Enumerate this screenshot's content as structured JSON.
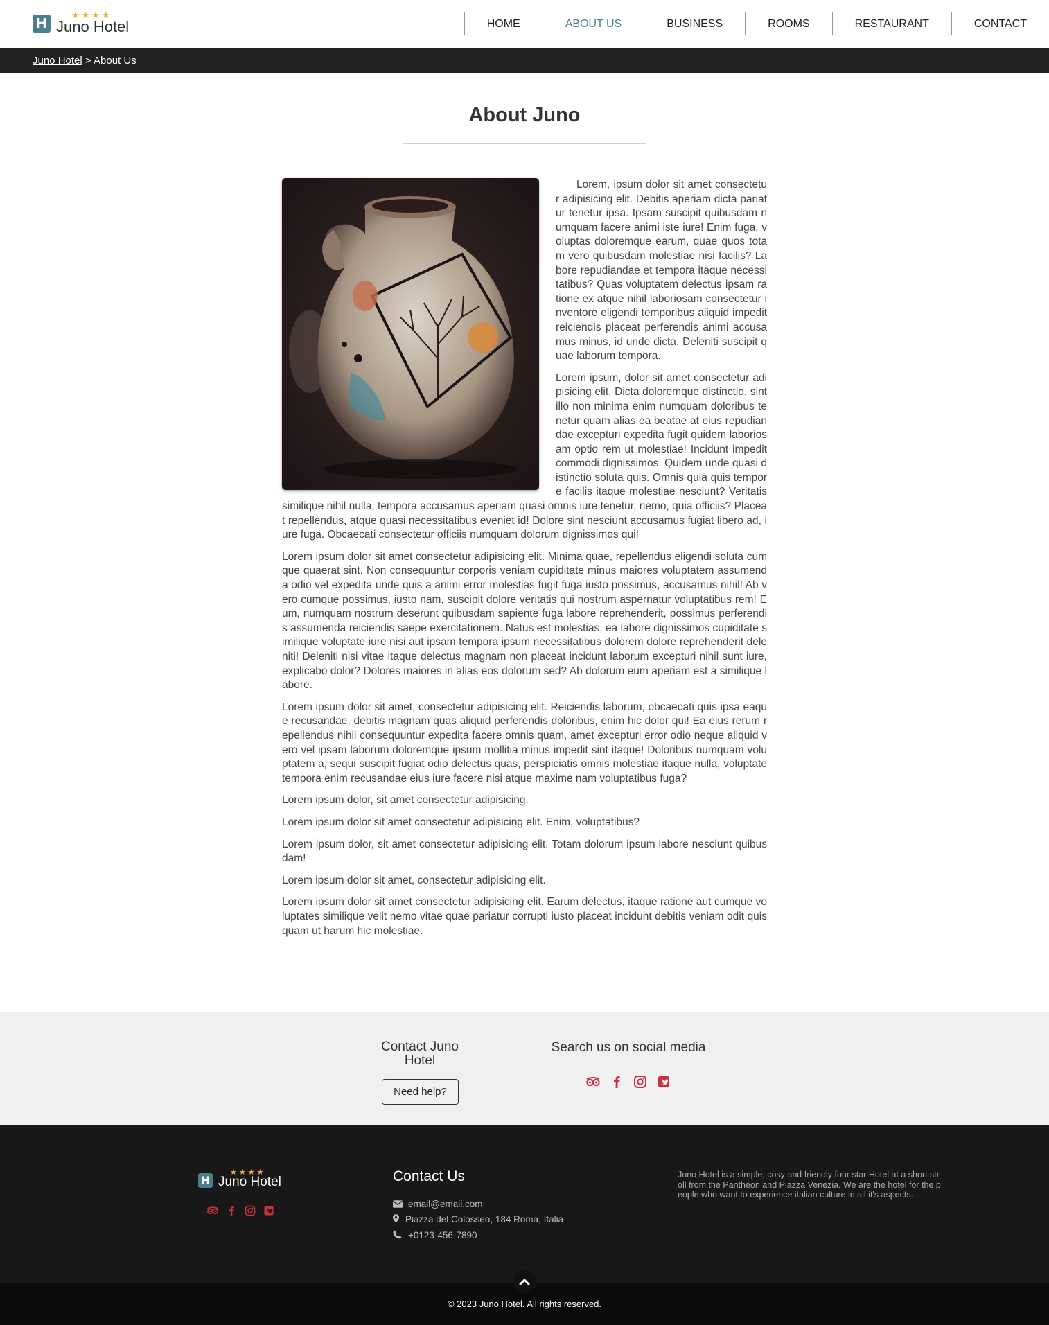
{
  "brand": {
    "name": "Juno Hotel",
    "logo_letter": "H",
    "stars": "★★★★"
  },
  "nav": {
    "items": [
      {
        "label": "HOME"
      },
      {
        "label": "ABOUT US"
      },
      {
        "label": "BUSINESS"
      },
      {
        "label": "ROOMS"
      },
      {
        "label": "RESTAURANT"
      },
      {
        "label": "CONTACT"
      }
    ],
    "active": "ABOUT US"
  },
  "breadcrumb": {
    "home": "Juno Hotel",
    "separator": " > ",
    "current": "About Us"
  },
  "main": {
    "title": "About Juno",
    "paragraphs": [
      "Lorem, ipsum dolor sit amet consectetur adipisicing elit. Debitis aperiam dicta pariatur tenetur ipsa. Ipsam suscipit quibusdam numquam facere animi iste iure! Enim fuga, voluptas doloremque earum, quae quos totam vero quibusdam molestiae nisi facilis? Labore repudiandae et tempora itaque necessitatibus? Quas voluptatem delectus ipsam ratione ex atque nihil laboriosam consectetur inventore eligendi temporibus aliquid impedit reiciendis placeat perferendis animi accusamus minus, id unde dicta. Deleniti suscipit quae laborum tempora.",
      "Lorem ipsum, dolor sit amet consectetur adipisicing elit. Dicta doloremque distinctio, sint illo non minima enim numquam doloribus tenetur quam alias ea beatae at eius repudiandae excepturi expedita fugit quidem laboriosam optio rem ut molestiae! Incidunt impedit commodi dignissimos. Quidem unde quasi distinctio soluta quis. Omnis quia quis tempore facilis itaque molestiae nesciunt? Veritatis similique nihil nulla, tempora accusamus aperiam quasi omnis iure tenetur, nemo, quia officiis? Placeat repellendus, atque quasi necessitatibus eveniet id! Dolore sint nesciunt accusamus fugiat libero ad, iure fuga. Obcaecati consectetur officiis numquam dolorum dignissimos qui!",
      "Lorem ipsum dolor sit amet consectetur adipisicing elit. Minima quae, repellendus eligendi soluta cumque quaerat sint. Non consequuntur corporis veniam cupiditate minus maiores voluptatem assumenda odio vel expedita unde quis a animi error molestias fugit fuga iusto possimus, accusamus nihil! Ab vero cumque possimus, iusto nam, suscipit dolore veritatis qui nostrum aspernatur voluptatibus rem! Eum, numquam nostrum deserunt quibusdam sapiente fuga labore reprehenderit, possimus perferendis assumenda reiciendis saepe exercitationem. Natus est molestias, ea labore dignissimos cupiditate similique voluptate iure nisi aut ipsam tempora ipsum necessitatibus dolorem dolore reprehenderit deleniti! Deleniti nisi vitae itaque delectus magnam non placeat incidunt laborum excepturi nihil sunt iure, explicabo dolor? Dolores maiores in alias eos dolorum sed? Ab dolorum eum aperiam est a similique labore.",
      "Lorem ipsum dolor sit amet, consectetur adipisicing elit. Reiciendis laborum, obcaecati quis ipsa eaque recusandae, debitis magnam quas aliquid perferendis doloribus, enim hic dolor qui! Ea eius rerum repellendus nihil consequuntur expedita facere omnis quam, amet excepturi error odio neque aliquid vero vel ipsam laborum doloremque ipsum mollitia minus impedit sint itaque! Doloribus numquam voluptatem a, sequi suscipit fugiat odio delectus quas, perspiciatis omnis molestiae itaque nulla, voluptate tempora enim recusandae eius iure facere nisi atque maxime nam voluptatibus fuga?",
      "Lorem ipsum dolor, sit amet consectetur adipisicing.",
      "Lorem ipsum dolor sit amet consectetur adipisicing elit. Enim, voluptatibus?",
      "Lorem ipsum dolor, sit amet consectetur adipisicing elit. Totam dolorum ipsum labore nesciunt quibus dam!",
      "Lorem ipsum dolor sit amet, consectetur adipisicing elit.",
      "Lorem ipsum dolor sit amet consectetur adipisicing elit. Earum delectus, itaque ratione aut cumque voluptates similique velit nemo vitae quae pariatur corrupti iusto placeat incidunt debitis veniam odit quisquam ut harum hic molestiae."
    ]
  },
  "contact_strip": {
    "left_title": "Contact Juno Hotel",
    "help_button": "Need help?",
    "right_title": "Search us on social media",
    "social_icons": [
      "tripadvisor-icon",
      "facebook-icon",
      "instagram-icon",
      "twitter-square-icon"
    ]
  },
  "footer": {
    "contact_title": "Contact Us",
    "email": "email@email.com",
    "address": "Piazza del Colosseo, 184 Roma, Italia",
    "phone": "+0123-456-7890",
    "about": "Juno Hotel is a simple, cosy and friendly four star Hotel at a short stroll from the Pantheon and Piazza Venezia. We are the hotel for the people who want to experience italian culture in all it's aspects.",
    "copyright": "© 2023 Juno Hotel. All rights reserved."
  },
  "colors": {
    "accent": "#4a7f8c",
    "star": "#f2a93b",
    "social": "#c8323f",
    "dark_bar": "#222222",
    "footer_bg": "#181818"
  }
}
